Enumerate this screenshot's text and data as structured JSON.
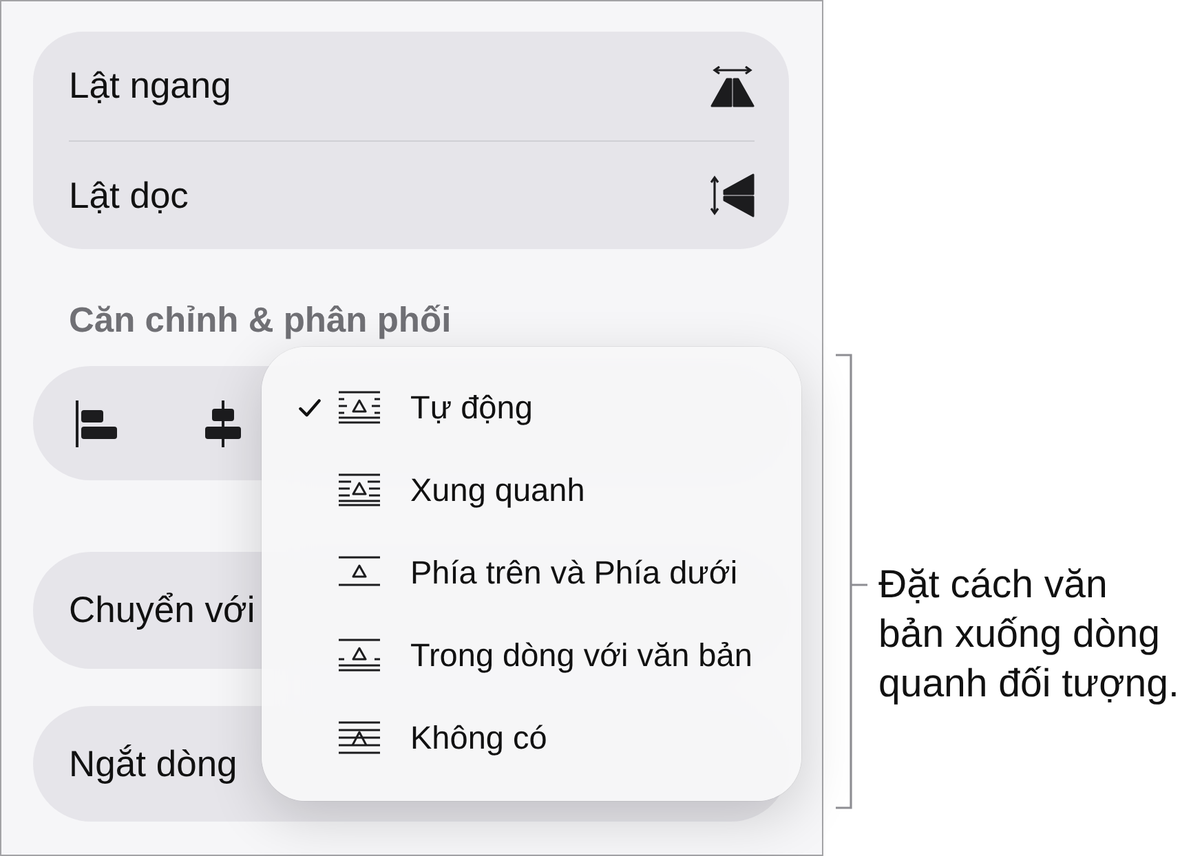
{
  "flip_options": [
    {
      "label": "Lật ngang",
      "kind": "flip-horizontal"
    },
    {
      "label": "Lật dọc",
      "kind": "flip-vertical"
    }
  ],
  "section_header": "Căn chỉnh & phân phối",
  "align_buttons": [
    {
      "kind": "align-left"
    },
    {
      "kind": "align-center"
    }
  ],
  "setting_rows": [
    {
      "label": "Chuyển với"
    },
    {
      "label": "Ngắt dòng"
    }
  ],
  "wrap_menu": {
    "items": [
      {
        "label": "Tự động",
        "kind": "auto",
        "selected": true
      },
      {
        "label": "Xung quanh",
        "kind": "around",
        "selected": false
      },
      {
        "label": "Phía trên và Phía dưới",
        "kind": "above-below",
        "selected": false
      },
      {
        "label": "Trong dòng với văn bản",
        "kind": "inline",
        "selected": false
      },
      {
        "label": "Không có",
        "kind": "none",
        "selected": false
      }
    ]
  },
  "callout": {
    "lines": [
      "Đặt cách văn",
      "bản xuống dòng",
      "quanh đối tượng."
    ]
  }
}
